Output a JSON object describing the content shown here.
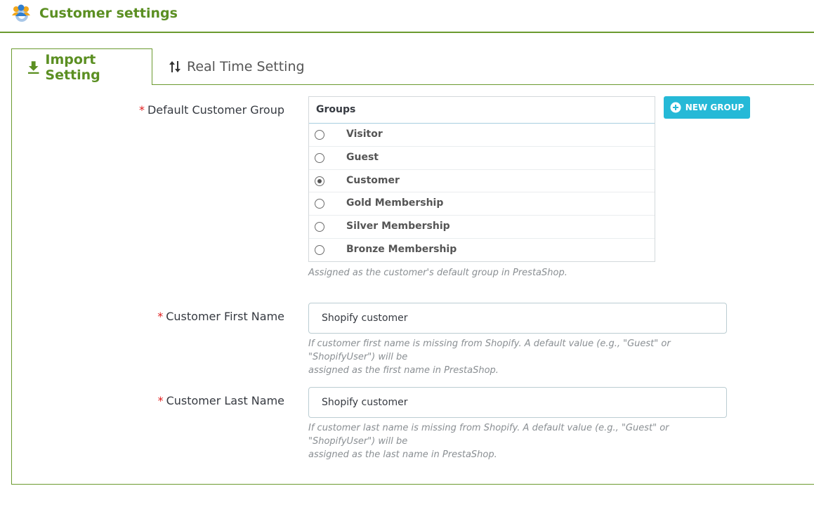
{
  "header": {
    "title": "Customer settings",
    "icon": "customers-gear-icon"
  },
  "tabs": [
    {
      "label": "Import Setting",
      "icon": "download-icon",
      "active": true
    },
    {
      "label": "Real Time Setting",
      "icon": "sync-arrows-icon",
      "active": false
    }
  ],
  "form": {
    "required_mark": "*",
    "default_group": {
      "label": "Default Customer Group",
      "table_header": "Groups",
      "groups": [
        {
          "name": "Visitor",
          "selected": false
        },
        {
          "name": "Guest",
          "selected": false
        },
        {
          "name": "Customer",
          "selected": true
        },
        {
          "name": "Gold Membership",
          "selected": false
        },
        {
          "name": "Silver Membership",
          "selected": false
        },
        {
          "name": "Bronze Membership",
          "selected": false
        }
      ],
      "help": "Assigned as the customer's default group in PrestaShop.",
      "new_group_button": "NEW GROUP"
    },
    "first_name": {
      "label": "Customer First Name",
      "value": "Shopify customer",
      "help_line1": "If customer first name is missing from Shopify. A default value (e.g., \"Guest\" or \"ShopifyUser\") will be",
      "help_line2": "assigned as the first name in PrestaShop."
    },
    "last_name": {
      "label": "Customer Last Name",
      "value": "Shopify customer",
      "help_line1": "If customer last name is missing from Shopify. A default value (e.g., \"Guest\" or \"ShopifyUser\") will be",
      "help_line2": "assigned as the last name in PrestaShop."
    }
  },
  "colors": {
    "accent_green": "#5b8f22",
    "border_green": "#6b9a2f",
    "button_blue": "#25b9d7",
    "required_red": "#e01b1b"
  }
}
